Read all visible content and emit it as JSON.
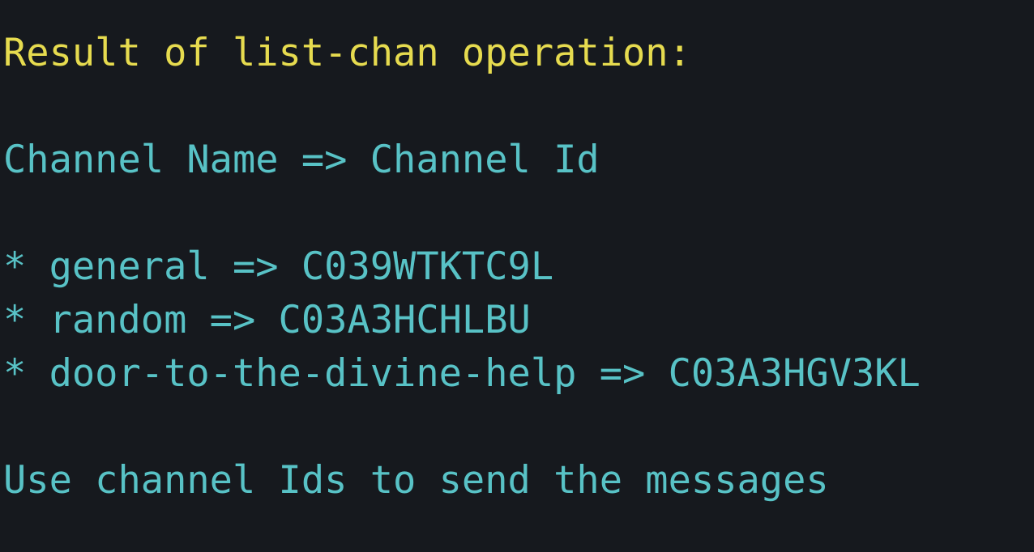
{
  "terminal": {
    "result_header": "Result of list-chan operation:",
    "table_header": "Channel Name => Channel Id",
    "channels": [
      "* general => C039WTKTC9L",
      "* random => C03A3HCHLBU",
      "* door-to-the-divine-help => C03A3HGV3KL"
    ],
    "footer_hint": "Use channel Ids to send the messages"
  },
  "colors": {
    "background": "#16191e",
    "header_text": "#e6db4f",
    "body_text": "#58c2c6"
  }
}
